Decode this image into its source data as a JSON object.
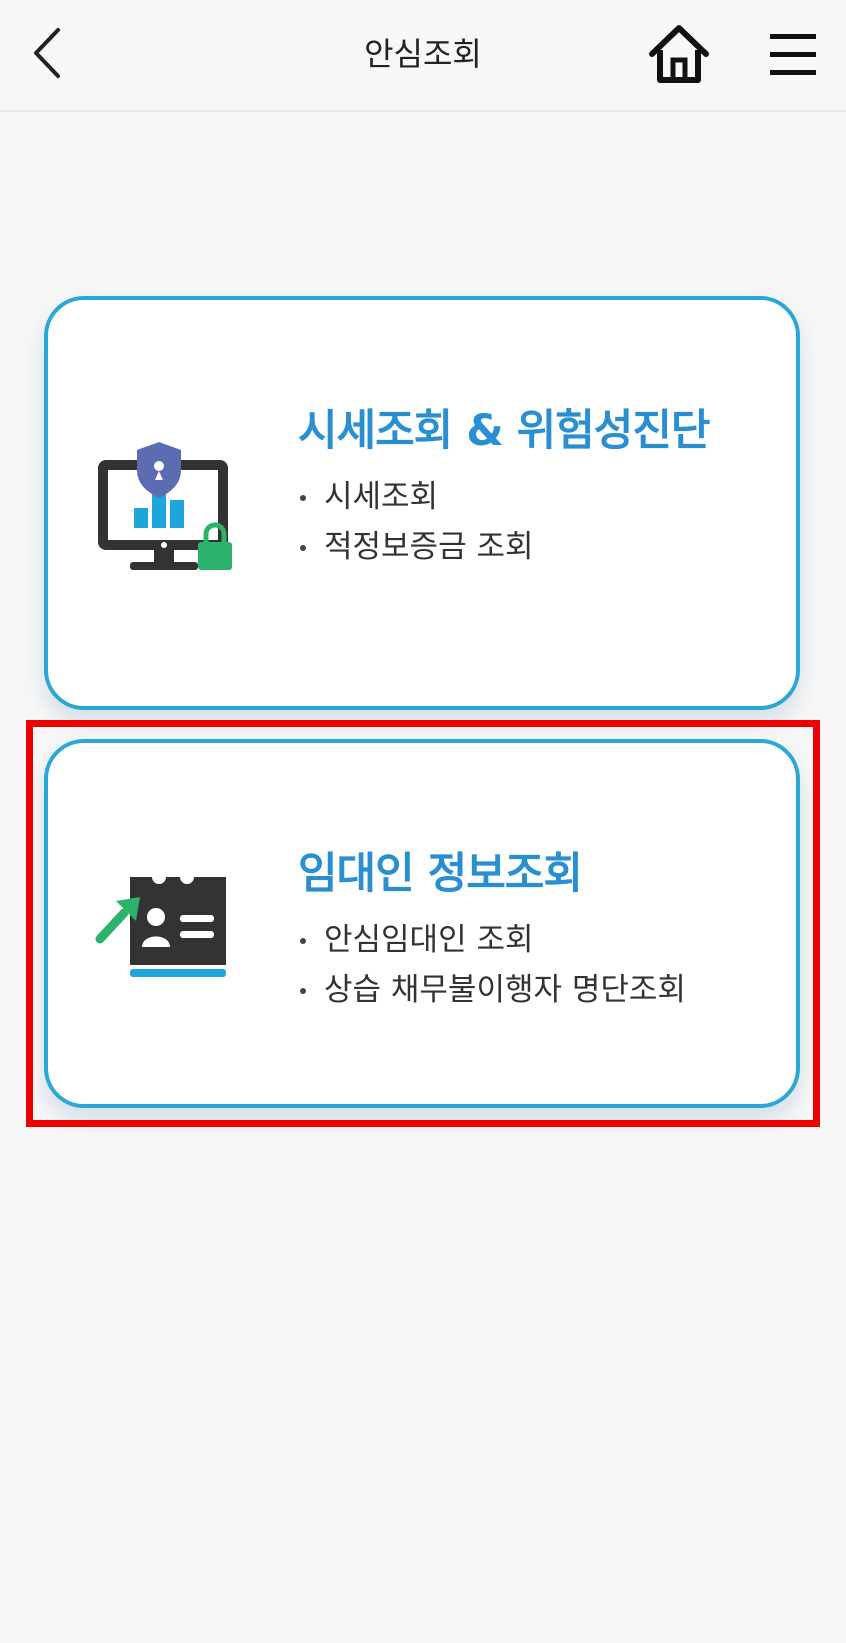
{
  "header": {
    "title": "안심조회"
  },
  "icons": {
    "back": "chevron-left-icon",
    "home": "home-icon",
    "menu": "hamburger-menu-icon",
    "card1": "monitor-chart-lock-icon",
    "card2": "id-card-arrow-icon"
  },
  "cards": [
    {
      "title": "시세조회 & 위험성진단",
      "items": [
        "시세조회",
        "적정보증금 조회"
      ]
    },
    {
      "title": "임대인 정보조회",
      "items": [
        "안심임대인 조회",
        "상습 채무불이행자 명단조회"
      ]
    }
  ],
  "colors": {
    "accent": "#2a8fd0",
    "card_border": "#29a8d6",
    "highlight": "#ee0000",
    "icon_dark": "#333333",
    "icon_green": "#2bb36b",
    "icon_purple": "#5b6cb3",
    "icon_blue": "#1ea6dc"
  }
}
